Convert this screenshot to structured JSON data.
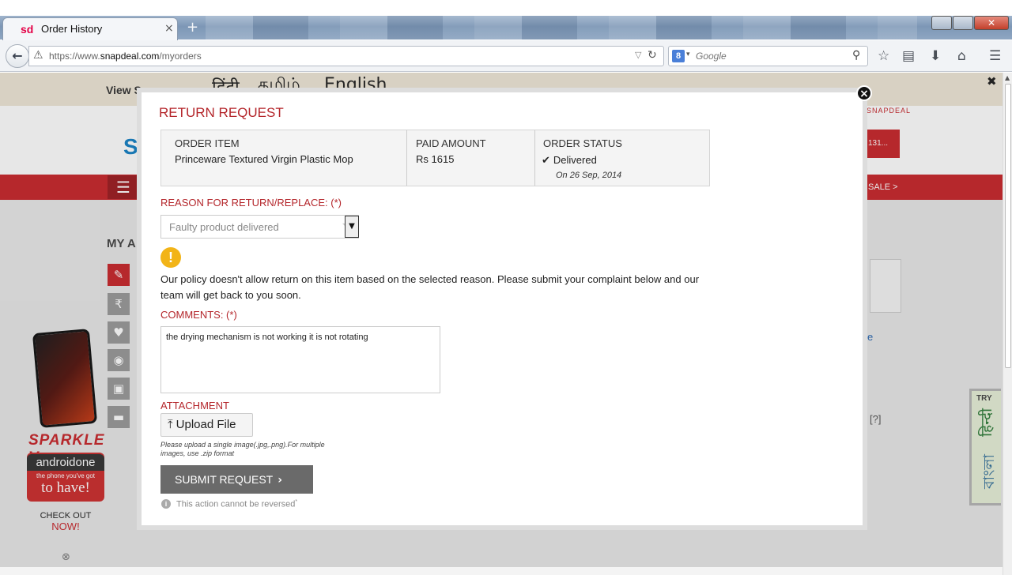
{
  "browser": {
    "tab": {
      "favicon": "sd",
      "title": "Order History",
      "close": "×"
    },
    "new_tab": "+",
    "window_controls": {
      "close": "✕"
    },
    "url": {
      "prefix": "https://www.",
      "domain": "snapdeal.com",
      "path": "/myorders"
    },
    "search": {
      "engine": "8",
      "placeholder": "Google"
    },
    "toolbar_icons": [
      "star-icon",
      "reading-list-icon",
      "download-icon",
      "home-icon",
      "menu-icon"
    ]
  },
  "background_page": {
    "lang_view": "View S",
    "lang_options": [
      "हिंदी",
      "தமிழ்",
      "English"
    ],
    "sale": "SALE >",
    "snapdeal_small": "SNAPDEAL",
    "account": "131...",
    "my_account": "MY A",
    "right_link_1": "e",
    "right_link_2": "[?]",
    "ad": {
      "brand": "SPARKLE V",
      "android": "androidone",
      "tagline_top": "the phone you've got",
      "tagline": "to have!",
      "check_out": "CHECK OUT",
      "now": "NOW!"
    },
    "try_tab": {
      "try": "TRY",
      "hindi": "हिन्दी",
      "bengali": "বাংলা"
    }
  },
  "modal": {
    "title": "RETURN REQUEST",
    "order": {
      "item_header": "ORDER ITEM",
      "item_value": "Princeware Textured Virgin Plastic Mop",
      "paid_header": "PAID AMOUNT",
      "paid_value": "Rs 1615",
      "status_header": "ORDER STATUS",
      "status_value": "Delivered",
      "status_date": "On 26 Sep, 2014"
    },
    "reason_label": "REASON FOR RETURN/REPLACE: (*)",
    "reason_value": "Faulty product delivered",
    "policy_text": "Our policy doesn't allow return on this item based on the selected reason. Please submit your complaint below and our team will get back to you soon.",
    "comments_label": "COMMENTS: (*)",
    "comments_value": "the drying mechanism is not working it is not rotating",
    "attachment_label": "ATTACHMENT",
    "upload_label": "Upload File",
    "upload_hint": "Please upload a single image(.jpg,.png).For multiple images, use .zip format",
    "submit_label": "SUBMIT REQUEST",
    "irreversible_note": "This action cannot be reversed",
    "irreversible_mark": "*"
  },
  "colors": {
    "accent_red": "#b4262b",
    "snapdeal_red": "#c8262b",
    "submit_gray": "#6a6a6a",
    "warning_yellow": "#f2b418"
  }
}
